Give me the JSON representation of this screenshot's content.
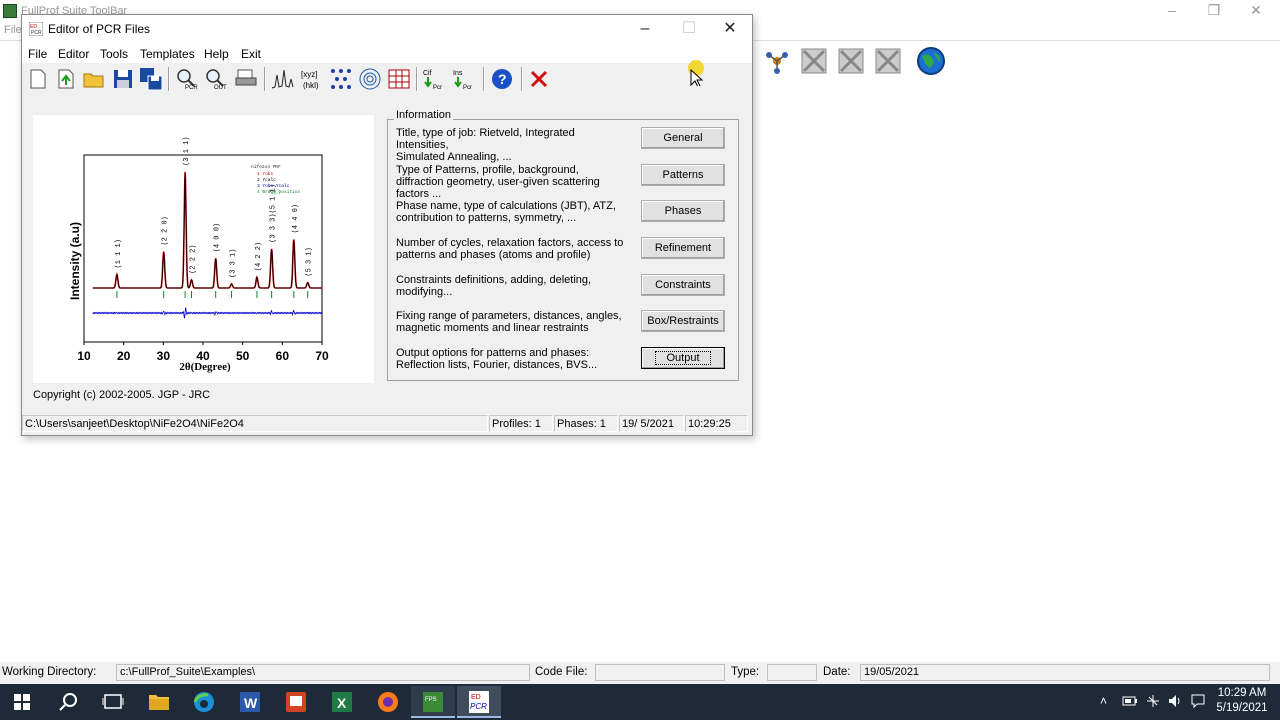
{
  "background_app": {
    "title": "FullProf Suite ToolBar",
    "menu_first": "File",
    "window_controls": [
      "minimize-icon",
      "restore-icon",
      "close-icon"
    ]
  },
  "dialog": {
    "title": "Editor of PCR Files",
    "menu": [
      "File",
      "Editor",
      "Tools",
      "Templates",
      "Help",
      "Exit"
    ],
    "toolbar_icons": [
      "new-file-icon",
      "import-icon",
      "open-folder-icon",
      "save-icon",
      "save-all-icon",
      "pcr-view-icon",
      "out-view-icon",
      "print-icon",
      "pattern-plot-icon",
      "hkl-icon",
      "crystal-structure-icon",
      "fourier-map-icon",
      "grid-icon",
      "cif-to-pcr-icon",
      "ins-to-pcr-icon",
      "help-icon",
      "exit-icon"
    ],
    "info_title": "Information",
    "sections": [
      {
        "desc": "Title, type of job: Rietveld, Integrated Intensities,\n Simulated Annealing, ...",
        "button": "General"
      },
      {
        "desc": "Type of Patterns, profile, background, diffraction geometry, user-given scattering factors ...",
        "button": "Patterns"
      },
      {
        "desc": "Phase name, type of calculations (JBT), ATZ, contribution to patterns, symmetry, ...",
        "button": "Phases"
      },
      {
        "desc": "Number of cycles, relaxation factors, access to patterns and phases (atoms and profile)",
        "button": "Refinement"
      },
      {
        "desc": "Constraints definitions, adding, deleting, modifying...",
        "button": "Constraints"
      },
      {
        "desc": "Fixing range of parameters, distances, angles, magnetic moments and linear restraints",
        "button": "Box/Restraints"
      },
      {
        "desc": "Output options for patterns and phases: Reflection lists, Fourier, distances, BVS...",
        "button": "Output"
      }
    ],
    "copyright": "Copyright (c) 2002-2005. JGP - JRC",
    "status": {
      "path": "C:\\Users\\sanjeet\\Desktop\\NiFe2O4\\NiFe2O4",
      "profiles": "Profiles:  1",
      "phases": "Phases:  1",
      "date": "19/ 5/2021",
      "time": "10:29:25"
    }
  },
  "chart_data": {
    "type": "line",
    "legend_title": "nife2o4 PRF",
    "legend": [
      "1  Yobs",
      "2  Ycalc",
      "3  Yobs-Ycalc",
      "4  Bragg_position"
    ],
    "xlabel": "2θ(Degree)",
    "ylabel": "Intensity (a.u)",
    "xlim": [
      10,
      70
    ],
    "xticks": [
      10,
      20,
      30,
      40,
      50,
      60,
      70
    ],
    "peaks": [
      {
        "x": 18.3,
        "label": "(1 1 1)",
        "height": 0.1
      },
      {
        "x": 30.1,
        "label": "(2 2 0)",
        "height": 0.27
      },
      {
        "x": 35.5,
        "label": "(3 1 1)",
        "height": 0.86
      },
      {
        "x": 37.1,
        "label": "(2 2 2)",
        "height": 0.06
      },
      {
        "x": 43.2,
        "label": "(4 0 0)",
        "height": 0.22
      },
      {
        "x": 47.2,
        "label": "(3 3 1)",
        "height": 0.03
      },
      {
        "x": 53.6,
        "label": "(4 2 2)",
        "height": 0.08
      },
      {
        "x": 57.3,
        "label": "(3 3 3)(5 1 1)",
        "height": 0.29
      },
      {
        "x": 62.9,
        "label": "(4 4 0)",
        "height": 0.36
      },
      {
        "x": 66.4,
        "label": "(5 3 1)",
        "height": 0.04
      }
    ],
    "colors": {
      "yobs": "#cc0000",
      "ycalc": "#000000",
      "diff": "#0000cc",
      "bragg": "#0a8a2a"
    }
  },
  "bottom_bar": {
    "working_dir_label": "Working Directory:",
    "working_dir": "c:\\FullProf_Suite\\Examples\\",
    "code_file_label": "Code File:",
    "code_file": "",
    "type_label": "Type:",
    "type": "",
    "date_label": "Date:",
    "date": "19/05/2021"
  },
  "taskbar": {
    "apps": [
      "windows-start-icon",
      "search-icon",
      "task-view-icon",
      "file-explorer-icon",
      "edge-icon",
      "word-icon",
      "powerpoint-icon",
      "excel-icon",
      "firefox-icon",
      "fps-toolbar-icon",
      "edpcr-icon"
    ],
    "time": "10:29 AM",
    "date": "5/19/2021"
  }
}
